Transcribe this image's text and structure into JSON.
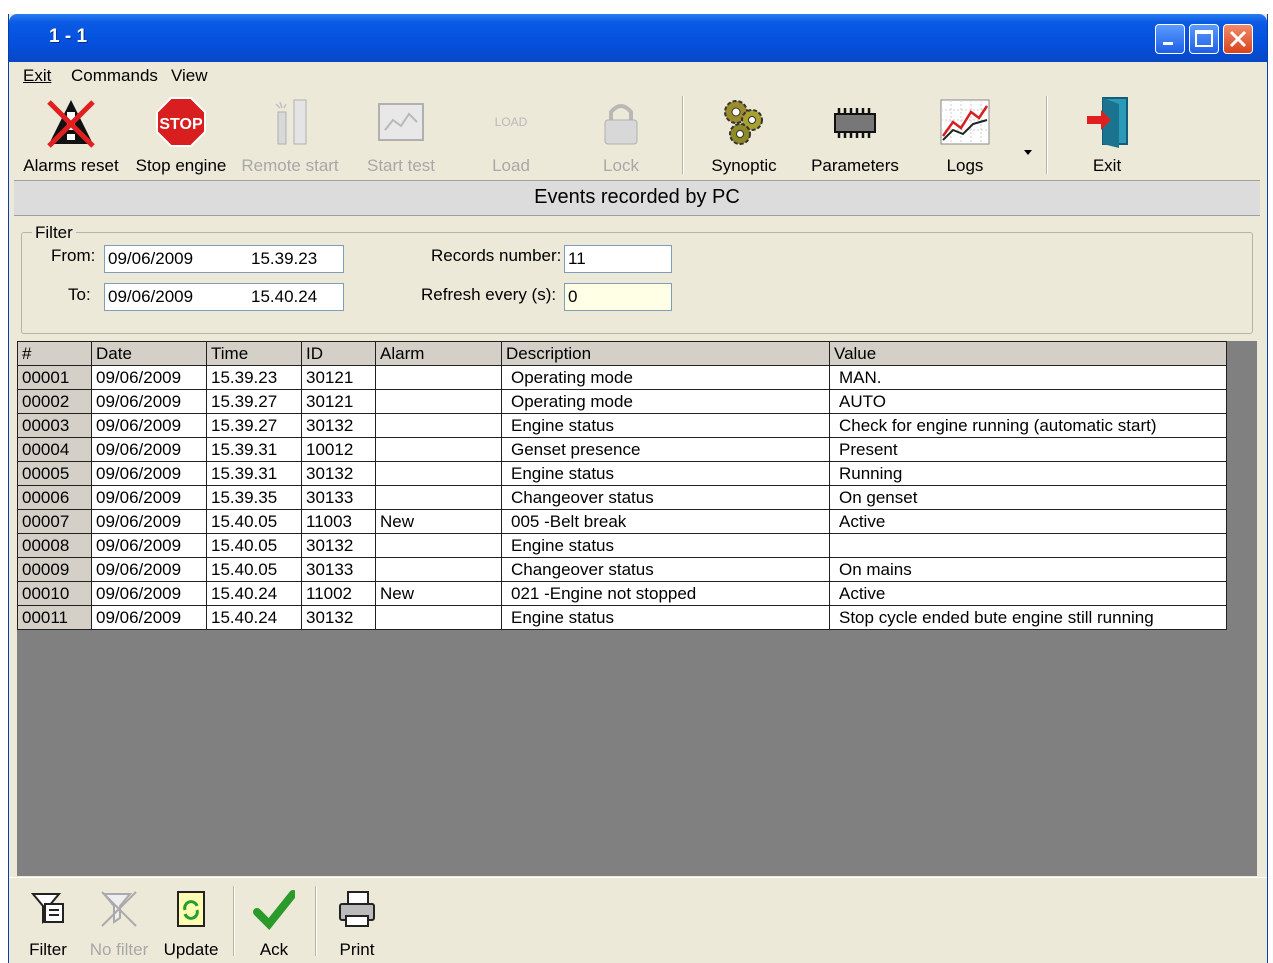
{
  "window": {
    "title": "1 - 1"
  },
  "menu": {
    "items": [
      "Exit",
      "Commands",
      "View"
    ]
  },
  "toolbar": {
    "items": [
      {
        "label": "Alarms reset",
        "icon": "alarms-reset-icon",
        "enabled": true
      },
      {
        "label": "Stop engine",
        "icon": "stop-icon",
        "enabled": true,
        "icon_text": "STOP"
      },
      {
        "label": "Remote start",
        "icon": "remote-start-icon",
        "enabled": false
      },
      {
        "label": "Start test",
        "icon": "start-test-icon",
        "enabled": false
      },
      {
        "label": "Load",
        "icon": "load-icon",
        "enabled": false,
        "icon_text": "LOAD"
      },
      {
        "label": "Lock",
        "icon": "lock-icon",
        "enabled": false
      },
      {
        "label": "Synoptic",
        "icon": "gears-icon",
        "enabled": true
      },
      {
        "label": "Parameters",
        "icon": "chip-icon",
        "enabled": true
      },
      {
        "label": "Logs",
        "icon": "chart-icon",
        "enabled": true
      },
      {
        "label": "Exit",
        "icon": "exit-door-icon",
        "enabled": true
      }
    ]
  },
  "banner": {
    "title": "Events recorded by PC"
  },
  "filter": {
    "legend": "Filter",
    "from_label": "From:",
    "from_date": "09/06/2009",
    "from_time": "15.39.23",
    "to_label": "To:",
    "to_date": "09/06/2009",
    "to_time": "15.40.24",
    "records_label": "Records number:",
    "records_value": "11",
    "refresh_label": "Refresh every (s):",
    "refresh_value": "0"
  },
  "table": {
    "columns": [
      "#",
      "Date",
      "Time",
      "ID",
      "Alarm",
      "Description",
      "Value"
    ],
    "rows": [
      [
        "00001",
        "09/06/2009",
        "15.39.23",
        "30121",
        "",
        "Operating mode",
        "MAN."
      ],
      [
        "00002",
        "09/06/2009",
        "15.39.27",
        "30121",
        "",
        "Operating mode",
        "AUTO"
      ],
      [
        "00003",
        "09/06/2009",
        "15.39.27",
        "30132",
        "",
        "Engine status",
        "Check for engine running (automatic start)"
      ],
      [
        "00004",
        "09/06/2009",
        "15.39.31",
        "10012",
        "",
        "Genset presence",
        "Present"
      ],
      [
        "00005",
        "09/06/2009",
        "15.39.31",
        "30132",
        "",
        "Engine status",
        "Running"
      ],
      [
        "00006",
        "09/06/2009",
        "15.39.35",
        "30133",
        "",
        "Changeover status",
        "On genset"
      ],
      [
        "00007",
        "09/06/2009",
        "15.40.05",
        "11003",
        "New",
        "005 -Belt break",
        "Active"
      ],
      [
        "00008",
        "09/06/2009",
        "15.40.05",
        "30132",
        "",
        "Engine status",
        ""
      ],
      [
        "00009",
        "09/06/2009",
        "15.40.05",
        "30133",
        "",
        "Changeover status",
        "On mains"
      ],
      [
        "00010",
        "09/06/2009",
        "15.40.24",
        "11002",
        "New",
        "021 -Engine not stopped",
        "Active"
      ],
      [
        "00011",
        "09/06/2009",
        "15.40.24",
        "30132",
        "",
        "Engine status",
        "Stop cycle ended bute engine still running"
      ]
    ]
  },
  "bottombar": {
    "items": [
      {
        "label": "Filter",
        "icon": "filter-icon",
        "enabled": true
      },
      {
        "label": "No filter",
        "icon": "no-filter-icon",
        "enabled": false
      },
      {
        "label": "Update",
        "icon": "update-icon",
        "enabled": true
      },
      {
        "label": "Ack",
        "icon": "checkmark-icon",
        "enabled": true
      },
      {
        "label": "Print",
        "icon": "printer-icon",
        "enabled": true
      }
    ]
  },
  "colors": {
    "titlebar": "#0550de",
    "window_bg": "#ece9d8",
    "grid_bg": "#808080",
    "stop_red": "#d81e1e",
    "check_green": "#2a9a2a"
  }
}
